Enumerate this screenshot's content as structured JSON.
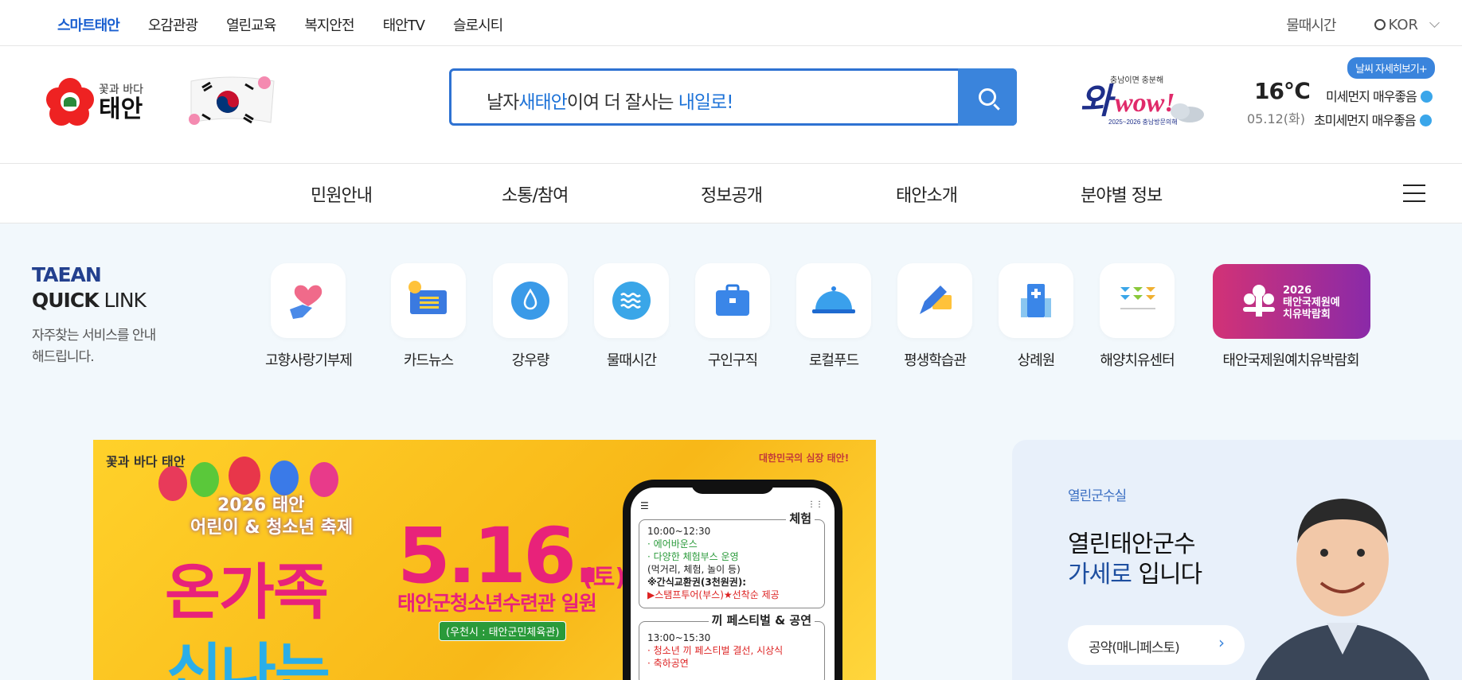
{
  "topnav": {
    "items": [
      {
        "label": "스마트태안",
        "active": true
      },
      {
        "label": "오감관광"
      },
      {
        "label": "열린교육"
      },
      {
        "label": "복지안전"
      },
      {
        "label": "태안TV"
      },
      {
        "label": "슬로시티"
      }
    ],
    "tide": "물때시간",
    "lang": "KOR"
  },
  "header": {
    "logo_sub": "꽃과 바다",
    "logo_main": "태안",
    "search": {
      "pre": "날자",
      "hl1": "새태안",
      "mid": "이여 더 잘사는 ",
      "hl2": "내일로!"
    },
    "weather": {
      "temp": "16℃",
      "date": "05.12(화)",
      "detail_btn": "날씨 자세히보기+",
      "fine_dust": "미세먼지 매우좋음",
      "ultra_dust": "초미세먼지 매우좋음"
    }
  },
  "mainnav": {
    "items": [
      "민원안내",
      "소통/참여",
      "정보공개",
      "태안소개",
      "분야별 정보"
    ]
  },
  "quicklink": {
    "title1": "TAEAN",
    "title2_bold": "QUICK",
    "title2_rest": " LINK",
    "desc": "자주찾는 서비스를 안내해드립니다.",
    "items": [
      {
        "label": "고향사랑기부제",
        "icon": "heart-hand-icon"
      },
      {
        "label": "카드뉴스",
        "icon": "card-news-icon"
      },
      {
        "label": "강우량",
        "icon": "rain-drop-icon"
      },
      {
        "label": "물때시간",
        "icon": "wave-icon"
      },
      {
        "label": "구인구직",
        "icon": "briefcase-icon"
      },
      {
        "label": "로컬푸드",
        "icon": "food-cloche-icon"
      },
      {
        "label": "평생학습관",
        "icon": "pencil-book-icon"
      },
      {
        "label": "상례원",
        "icon": "building-icon"
      },
      {
        "label": "해양치유센터",
        "icon": "healing-center-icon"
      },
      {
        "label": "태안국제원예치유박람회",
        "icon": "expo-logo-icon"
      }
    ],
    "expo_badge": {
      "year": "2026",
      "line1": "태안국제원예",
      "line2": "치유박람회"
    }
  },
  "banner": {
    "logo": "꽃과 바다 태안",
    "slogan": "대한민국의 심장 태안!",
    "year": "2026 태안",
    "festival": "어린이 & 청소년 축제",
    "big1": "온가족",
    "big2": "신나는",
    "date": "5.16.",
    "day": "(토)",
    "place": "태안군청소년수련관 일원",
    "rain_place": "(우천시 : 태안군민체육관)",
    "box1": {
      "head": "체험",
      "time": "10:00~12:30",
      "l1": "· 에어바운스",
      "l2": "· 다양한 체험부스 운영",
      "l3": "(먹거리, 체험, 놀이 등)",
      "l4": "※간식교환권(3천원권):",
      "l5": "▶스탬프투어(부스)★선착순 제공"
    },
    "box2": {
      "head": "끼 페스티벌 & 공연",
      "time": "13:00~15:30",
      "l1": "· 청소년 끼 페스티벌 결선, 시상식",
      "l2": "· 축하공연"
    }
  },
  "mayor": {
    "label": "열린군수실",
    "line1": "열린태안군수",
    "line2_hl": "가세로",
    "line2_rest": " 입니다",
    "button": "공약(매니페스토)"
  },
  "colors": {
    "primary": "#3a84dc",
    "navy": "#23408e",
    "pink": "#e8227a",
    "quick_bg": "#f2f8fc"
  }
}
